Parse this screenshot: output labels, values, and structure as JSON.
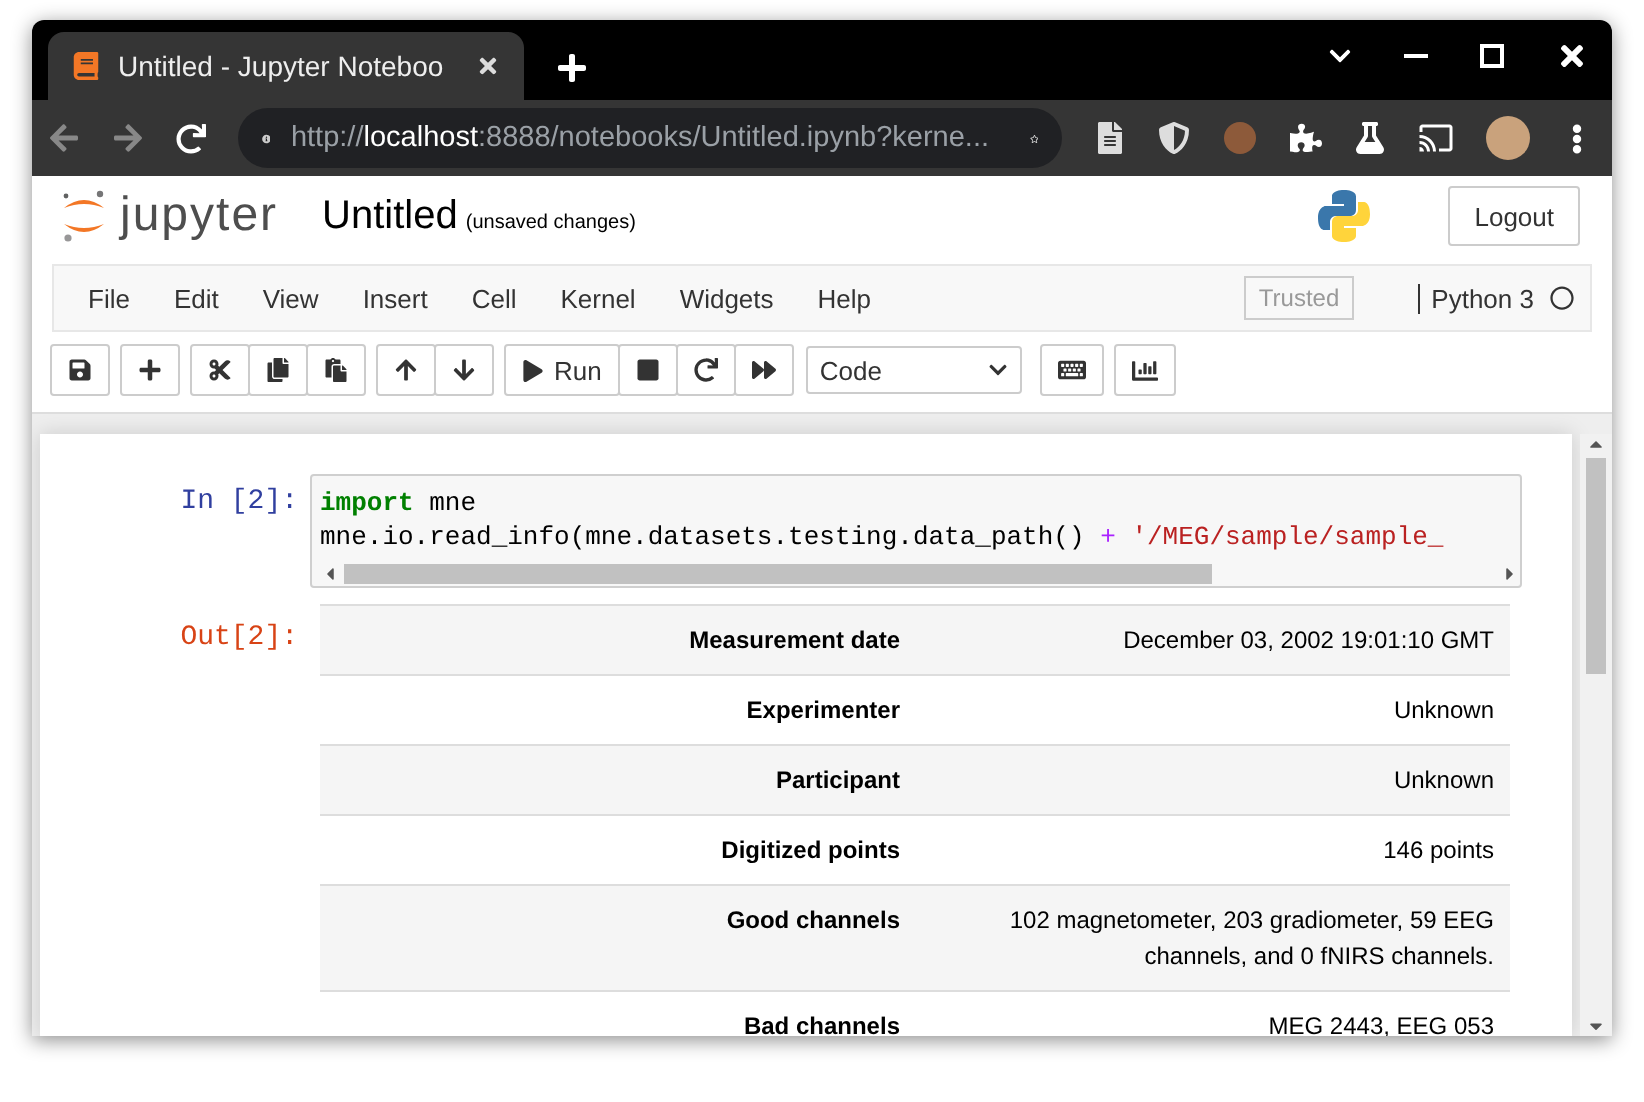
{
  "browser": {
    "tab_title": "Untitled - Jupyter Noteboo",
    "url": [
      {
        "text": "http://",
        "emphasis": false
      },
      {
        "text": "localhost",
        "emphasis": true
      },
      {
        "text": ":8888/notebooks/Untitled.ipynb?kerne...",
        "emphasis": false
      }
    ]
  },
  "header": {
    "logo_text": "jupyter",
    "notebook_name": "Untitled",
    "save_status": "(unsaved changes)",
    "logout": "Logout"
  },
  "menu": {
    "items": [
      "File",
      "Edit",
      "View",
      "Insert",
      "Cell",
      "Kernel",
      "Widgets",
      "Help"
    ],
    "trusted": "Trusted",
    "kernel": "Python 3"
  },
  "toolbar": {
    "run": "Run",
    "cell_type": "Code"
  },
  "cell": {
    "in_prompt": "In [2]:",
    "out_prompt": "Out[2]:",
    "code": [
      [
        {
          "kind": "keyword",
          "text": "import"
        },
        {
          "kind": "name",
          "text": " mne"
        }
      ],
      [
        {
          "kind": "name",
          "text": "mne.io.read_info(mne.datasets.testing.data_path() "
        },
        {
          "kind": "operator",
          "text": "+"
        },
        {
          "kind": "string",
          "text": " '/MEG/sample/sample_"
        }
      ]
    ],
    "rows": [
      {
        "label": "Measurement date",
        "value": "December 03, 2002 19:01:10 GMT"
      },
      {
        "label": "Experimenter",
        "value": "Unknown"
      },
      {
        "label": "Participant",
        "value": "Unknown"
      },
      {
        "label": "Digitized points",
        "value": "146 points"
      },
      {
        "label": "Good channels",
        "value": "102 magnetometer, 203 gradiometer, 59 EEG channels, and 0 fNIRS channels."
      },
      {
        "label": "Bad channels",
        "value": "MEG 2443, EEG 053"
      }
    ]
  }
}
